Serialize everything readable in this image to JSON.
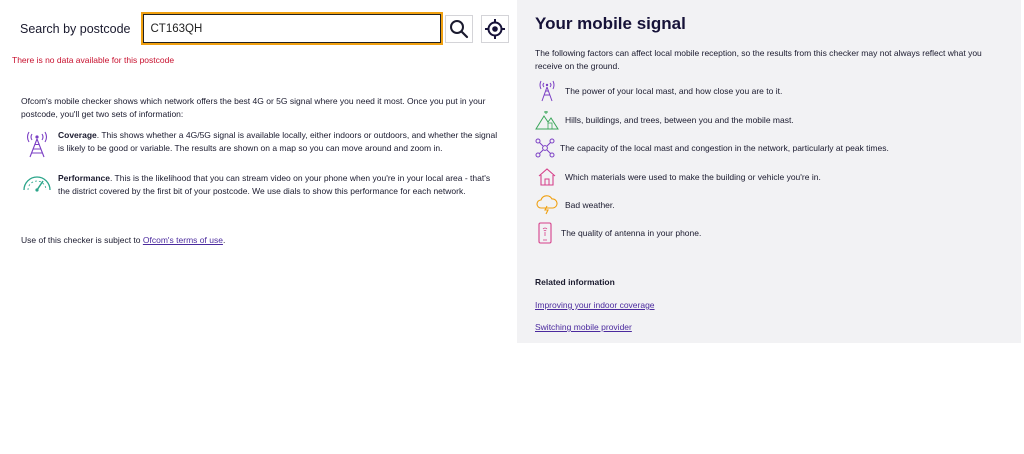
{
  "search": {
    "label": "Search by postcode",
    "value": "CT163QH",
    "search_icon": "search-icon",
    "location_icon": "locate-icon"
  },
  "error": "There is no data available for this postcode",
  "intro": "Ofcom's mobile checker shows which network offers the best 4G or 5G signal where you need it most. Once you put in your postcode, you'll get two sets of information:",
  "coverage": {
    "title": "Coverage",
    "text": ". This shows whether a 4G/5G signal is available locally, either indoors or outdoors, and whether the signal is likely to be good or variable. The results are shown on a map so you can move around and zoom in.",
    "icon": "antenna-icon"
  },
  "performance": {
    "title": "Performance",
    "text": ". This is the likelihood that you can stream video on your phone when you're in your local area - that's the district covered by the first bit of your postcode. We use dials to show this performance for each network.",
    "icon": "speed-dial-icon"
  },
  "terms": {
    "prefix": "Use of this checker is subject to ",
    "link": "Ofcom's terms of use",
    "suffix": "."
  },
  "signal": {
    "title": "Your mobile signal",
    "intro": "The following factors can affect local mobile reception, so the results from this checker may not always reflect what you receive on the ground.",
    "factors": [
      {
        "text": "The power of your local mast, and how close you are to it.",
        "icon": "mast-icon",
        "color": "#7b3fc4"
      },
      {
        "text": "Hills, buildings, and trees, between you and the mobile mast.",
        "icon": "hills-icon",
        "color": "#3aa65a"
      },
      {
        "text": "The capacity of the local mast and congestion in the network, particularly at peak times.",
        "icon": "network-icon",
        "color": "#7b3fc4"
      },
      {
        "text": "Which materials were used to make the building or vehicle you're in.",
        "icon": "house-icon",
        "color": "#d6408a"
      },
      {
        "text": "Bad weather.",
        "icon": "storm-cloud-icon",
        "color": "#f0a010"
      },
      {
        "text": "The quality of antenna in your phone.",
        "icon": "phone-icon",
        "color": "#d6408a"
      }
    ]
  },
  "related": {
    "title": "Related information",
    "links": [
      "Improving your indoor coverage",
      "Switching mobile provider"
    ]
  },
  "colors": {
    "accent_orange": "#f0a010",
    "error_red": "#c8102e",
    "link_purple": "#4b2a9e",
    "panel_bg": "#f2f2f4"
  }
}
